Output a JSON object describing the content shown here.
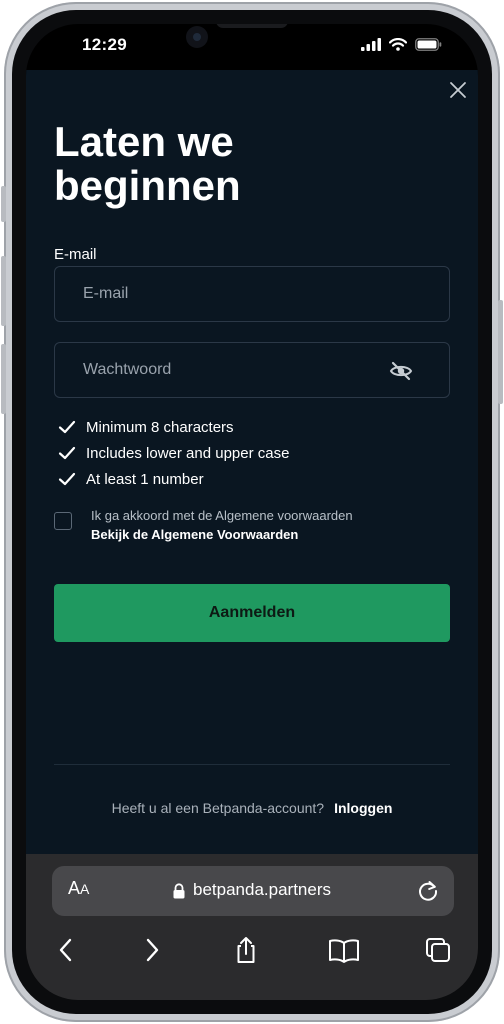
{
  "status_bar": {
    "time": "12:29"
  },
  "modal": {
    "title": "Laten we beginnen",
    "email_label": "E-mail",
    "email_placeholder": "E-mail",
    "password_placeholder": "Wachtwoord",
    "requirements": [
      "Minimum 8 characters",
      "Includes lower and upper case",
      "At least 1 number"
    ],
    "terms_text": "Ik ga akkoord met de Algemene voorwaarden",
    "terms_link": "Bekijk de Algemene Voorwaarden",
    "submit_label": "Aanmelden",
    "login_question": "Heeft u al een Betpanda-account?",
    "login_link": "Inloggen"
  },
  "browser": {
    "text_size_big": "A",
    "text_size_small": "A",
    "url": "betpanda.partners"
  },
  "colors": {
    "background": "#0a1621",
    "accent": "#1f9960",
    "safari_bar": "#2b2b2d"
  }
}
